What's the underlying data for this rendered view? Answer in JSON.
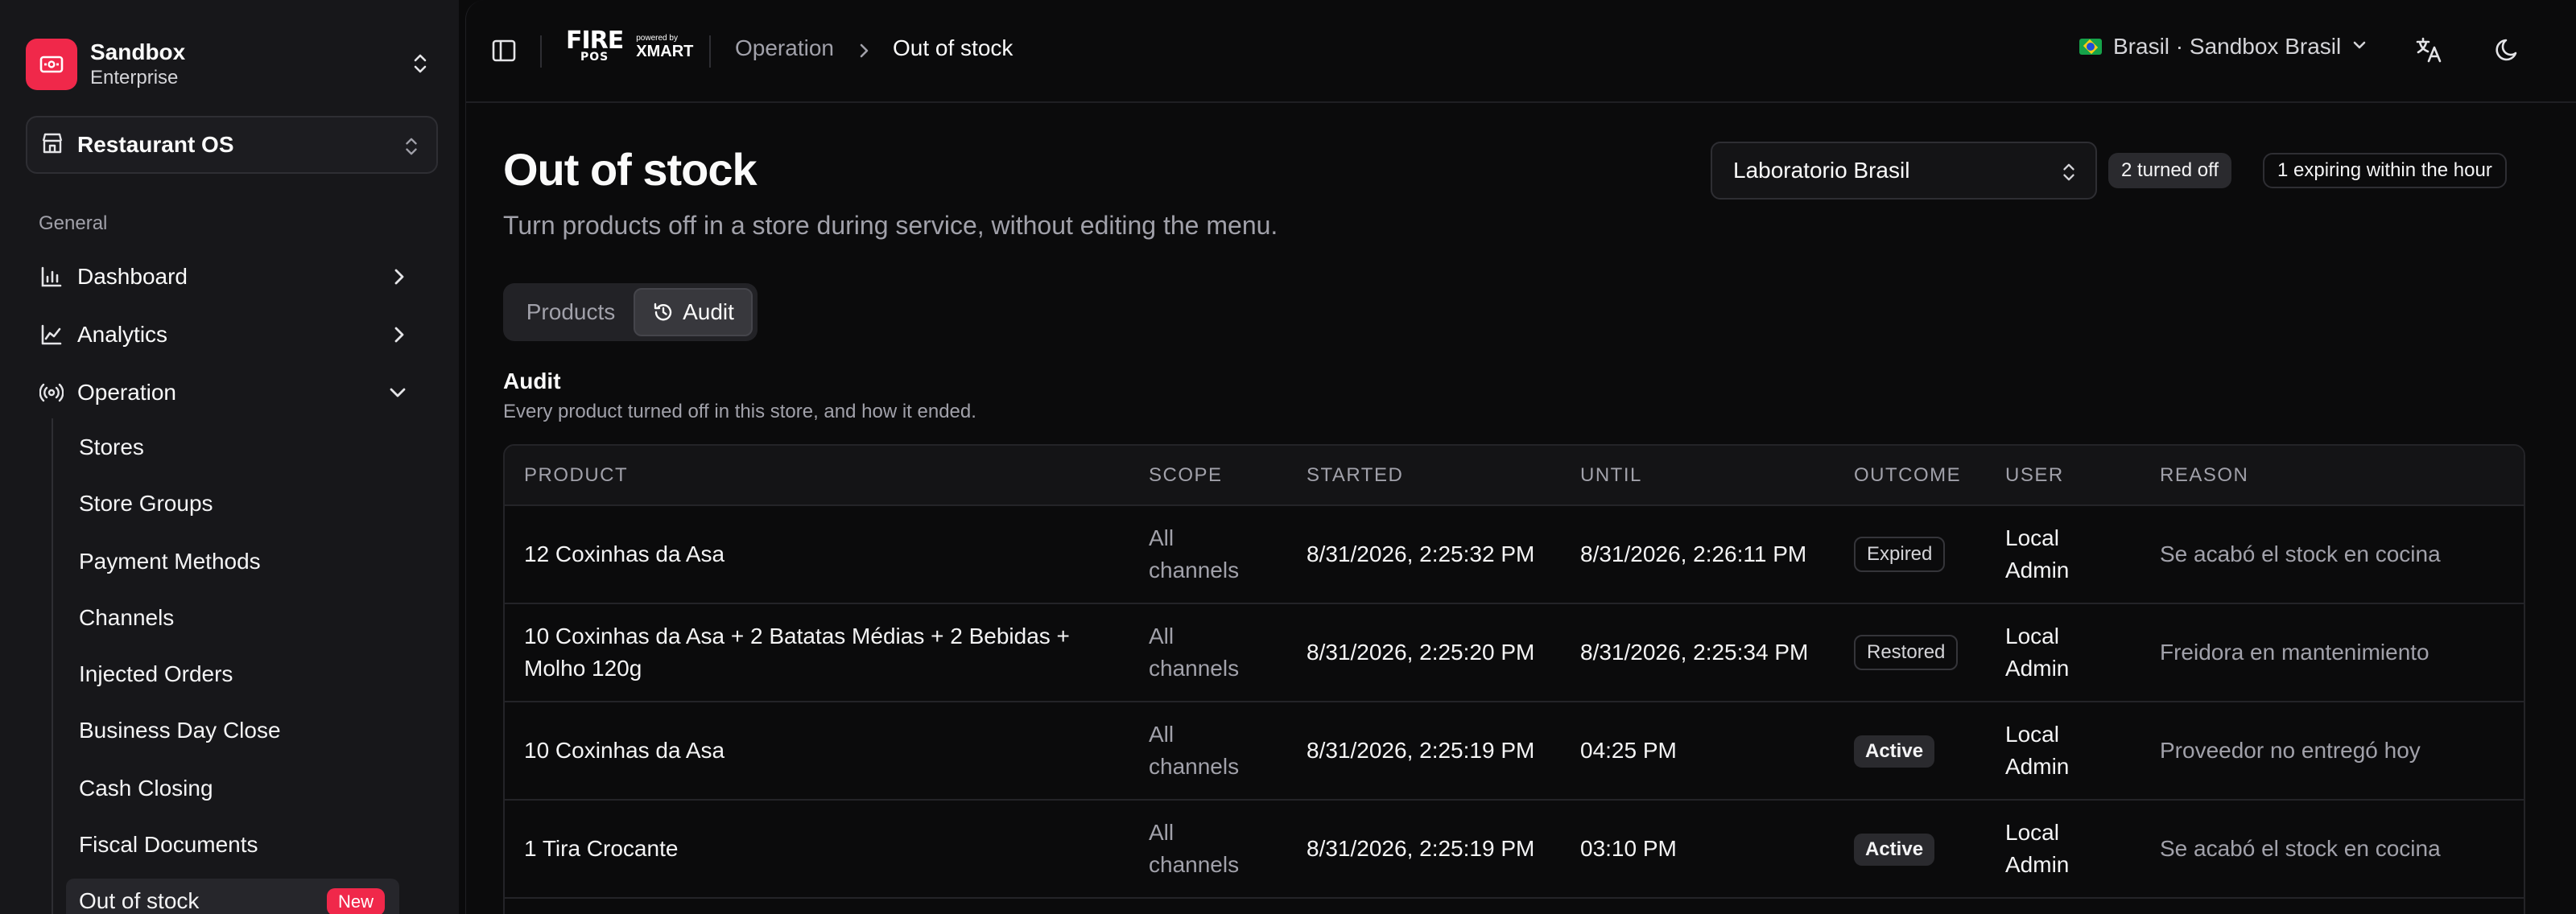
{
  "org": {
    "name": "Sandbox",
    "plan": "Enterprise"
  },
  "app_selector": {
    "label": "Restaurant OS"
  },
  "sidebar": {
    "group_label": "General",
    "items": [
      {
        "label": "Dashboard",
        "icon": "bar-chart-icon"
      },
      {
        "label": "Analytics",
        "icon": "line-chart-icon"
      },
      {
        "label": "Operation",
        "icon": "broadcast-icon"
      }
    ],
    "sub_items": [
      {
        "label": "Stores"
      },
      {
        "label": "Store Groups"
      },
      {
        "label": "Payment Methods"
      },
      {
        "label": "Channels"
      },
      {
        "label": "Injected Orders"
      },
      {
        "label": "Business Day Close"
      },
      {
        "label": "Cash Closing"
      },
      {
        "label": "Fiscal Documents"
      },
      {
        "label": "Out of stock",
        "badge": "New",
        "active": true
      }
    ]
  },
  "topbar": {
    "brand": {
      "name_top": "FIRE",
      "name_bottom": "POS",
      "powered_by": "powered by",
      "partner": "XMART"
    },
    "breadcrumb": [
      "Operation",
      "Out of stock"
    ],
    "locale": "Brasil · Sandbox Brasil"
  },
  "page": {
    "title": "Out of stock",
    "subtitle": "Turn products off in a store during service, without editing the menu.",
    "store_select": "Laboratorio Brasil",
    "pill_turned_off": "2 turned off",
    "pill_expiring": "1 expiring within the hour",
    "tabs": [
      "Products",
      "Audit"
    ],
    "active_tab": "Audit",
    "section_title": "Audit",
    "section_subtitle": "Every product turned off in this store, and how it ended."
  },
  "table": {
    "headers": [
      "PRODUCT",
      "SCOPE",
      "STARTED",
      "UNTIL",
      "OUTCOME",
      "USER",
      "REASON"
    ],
    "rows": [
      {
        "product": "12 Coxinhas da Asa",
        "scope": "All channels",
        "started": "8/31/2026, 2:25:32 PM",
        "until": "8/31/2026, 2:26:11 PM",
        "outcome": "Expired",
        "user": "Local Admin",
        "reason": "Se acabó el stock en cocina"
      },
      {
        "product": "10 Coxinhas da Asa + 2 Batatas Médias + 2 Bebidas + Molho 120g",
        "scope": "All channels",
        "started": "8/31/2026, 2:25:20 PM",
        "until": "8/31/2026, 2:25:34 PM",
        "outcome": "Restored",
        "user": "Local Admin",
        "reason": "Freidora en mantenimiento"
      },
      {
        "product": "10 Coxinhas da Asa",
        "scope": "All channels",
        "started": "8/31/2026, 2:25:19 PM",
        "until": "04:25 PM",
        "outcome": "Active",
        "user": "Local Admin",
        "reason": "Proveedor no entregó hoy"
      },
      {
        "product": "1 Tira Crocante",
        "scope": "All channels",
        "started": "8/31/2026, 2:25:19 PM",
        "until": "03:10 PM",
        "outcome": "Active",
        "user": "Local Admin",
        "reason": "Se acabó el stock en cocina"
      }
    ]
  },
  "colors": {
    "accent": "#f0284a",
    "background": "#0a0a0b",
    "sidebar": "#17171a",
    "muted_text": "#a1a1aa"
  }
}
